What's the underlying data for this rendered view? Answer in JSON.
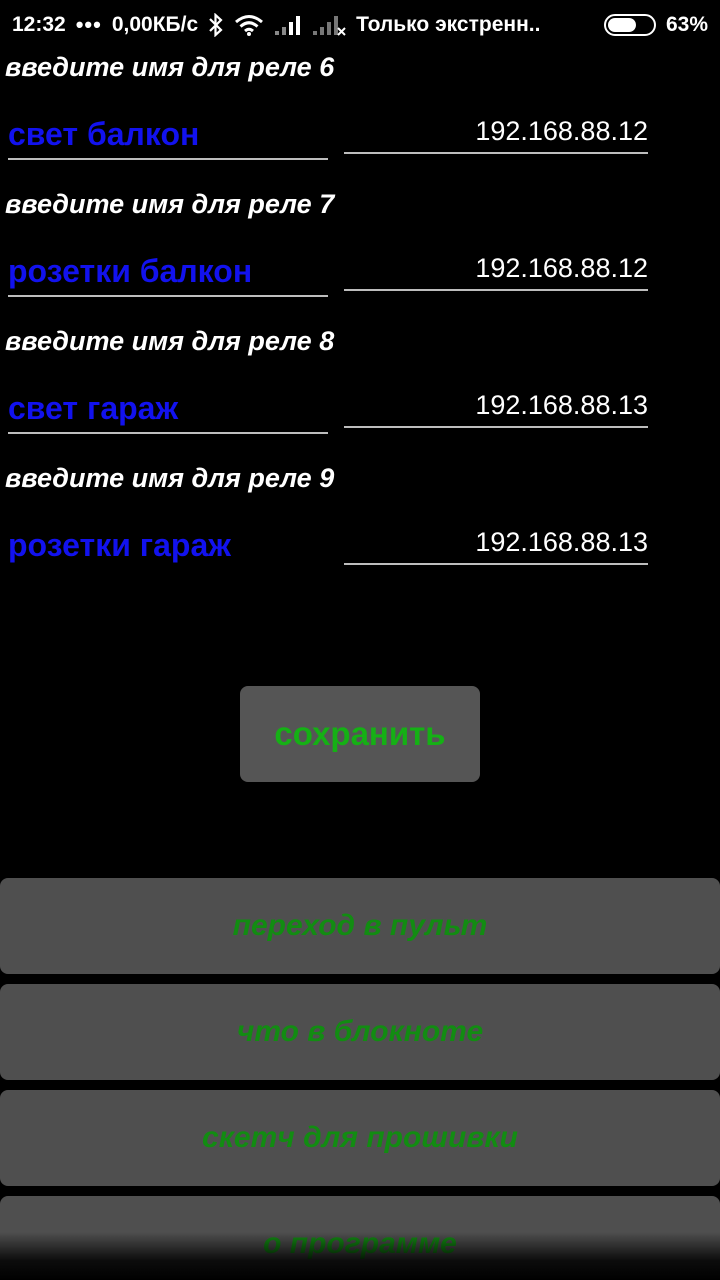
{
  "status_bar": {
    "time": "12:32",
    "dots": "•••",
    "speed": "0,00КБ/с",
    "carrier": "Только экстренн..",
    "battery": "63%",
    "battery_level": 0.63
  },
  "relays": [
    {
      "label": "введите имя для реле 6",
      "name": "свет балкон",
      "ip": "192.168.88.12"
    },
    {
      "label": "введите имя для реле 7",
      "name": "розетки балкон",
      "ip": "192.168.88.12"
    },
    {
      "label": "введите имя для реле 8",
      "name": "свет гараж",
      "ip": "192.168.88.13"
    },
    {
      "label": "введите имя для реле 9",
      "name": "розетки гараж",
      "ip": "192.168.88.13"
    }
  ],
  "save_button": "сохранить",
  "nav_buttons": [
    "переход в пульт",
    "что в блокноте",
    "скетч для прошивки",
    "о программе"
  ],
  "colors": {
    "background": "#000000",
    "relay_name": "#1212ee",
    "save_text": "#15b015",
    "nav_text": "#128c12",
    "button_bg": "#4f4f4f"
  }
}
